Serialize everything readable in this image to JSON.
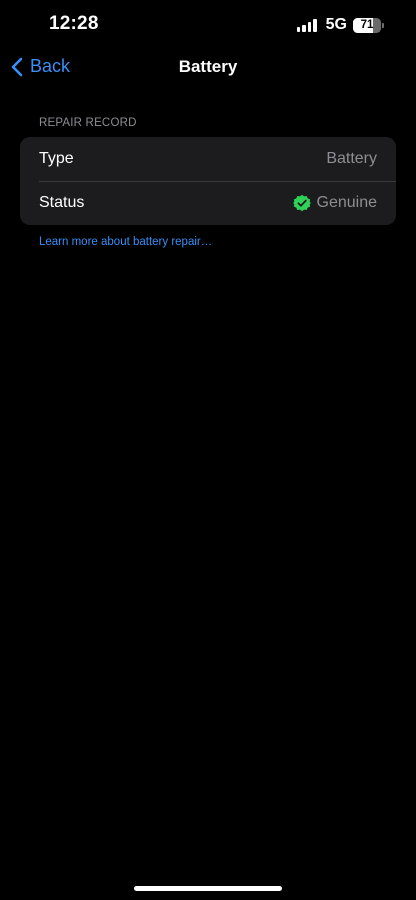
{
  "status_bar": {
    "time": "12:28",
    "network": "5G",
    "battery_level": "71",
    "battery_fraction": 0.71,
    "signal_bars": 4
  },
  "nav": {
    "back_label": "Back",
    "title": "Battery"
  },
  "repair_record": {
    "header": "REPAIR RECORD",
    "rows": [
      {
        "label": "Type",
        "value": "Battery"
      },
      {
        "label": "Status",
        "value": "Genuine",
        "icon": "verified-check-icon",
        "icon_color": "#30d158"
      }
    ],
    "footer_link": "Learn more about battery repair…"
  },
  "colors": {
    "accent": "#3a8ef6",
    "background": "#000000",
    "group_background": "#1c1c1e",
    "secondary_text": "#8d8d93",
    "verified": "#30d158"
  }
}
